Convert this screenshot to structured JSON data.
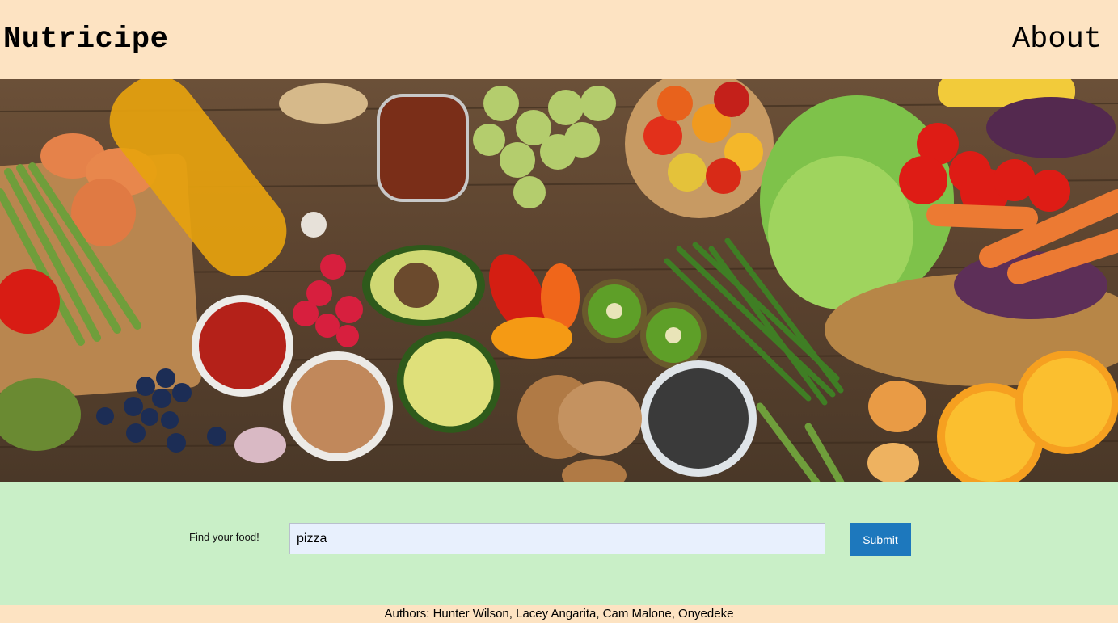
{
  "header": {
    "brand": "Nutricipe",
    "nav_about": "About"
  },
  "search": {
    "label": "Find your food!",
    "value": "pizza",
    "submit_label": "Submit"
  },
  "footer": {
    "authors": "Authors: Hunter Wilson, Lacey Angarita, Cam Malone, Onyedeke"
  },
  "colors": {
    "header_bg": "#fde3c2",
    "search_band_bg": "#c9efc7",
    "submit_bg": "#1d78bd",
    "input_bg": "#e8f0fd"
  }
}
